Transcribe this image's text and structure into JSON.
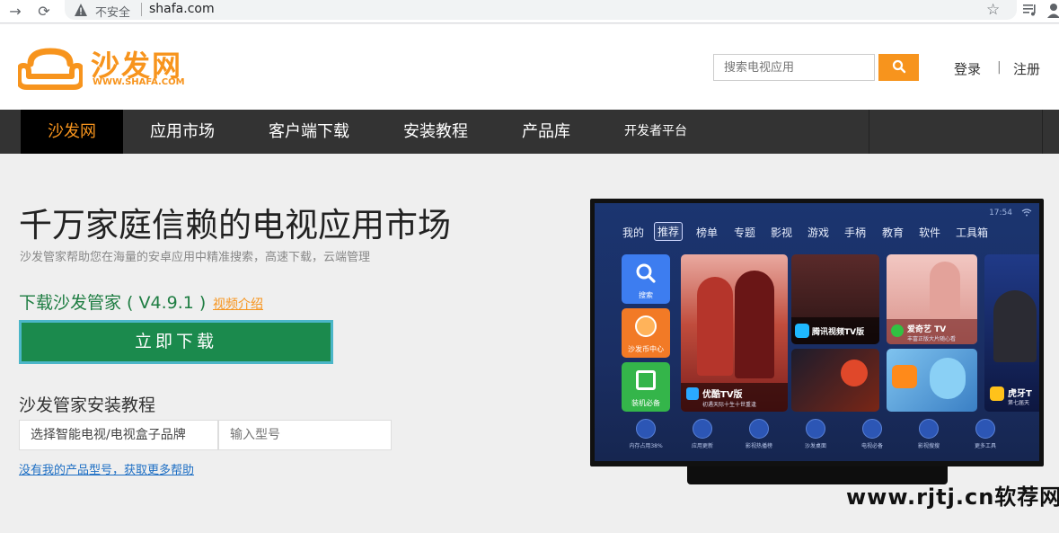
{
  "browser": {
    "security_label": "不安全",
    "url": "shafa.com"
  },
  "header": {
    "logo_cn": "沙发网",
    "logo_en": "WWW.SHAFA.COM",
    "search_placeholder": "搜索电视应用",
    "login": "登录",
    "separator": "|",
    "register": "注册"
  },
  "nav": {
    "items": [
      {
        "label": "沙发网"
      },
      {
        "label": "应用市场"
      },
      {
        "label": "客户端下载"
      },
      {
        "label": "安装教程"
      },
      {
        "label": "产品库"
      },
      {
        "label": "开发者平台"
      }
    ]
  },
  "hero": {
    "title": "千万家庭信赖的电视应用市场",
    "subtitle": "沙发管家帮助您在海量的安卓应用中精准搜索，高速下载，云端管理",
    "download_title": "下载沙发管家 ( V4.9.1 )",
    "video_link": "视频介绍",
    "download_button": "立即下载",
    "tutorial_title": "沙发管家安装教程",
    "brand_select": "选择智能电视/电视盒子品牌",
    "model_placeholder": "输入型号",
    "help_link": "没有我的产品型号，获取更多帮助"
  },
  "tv": {
    "time": "17:54",
    "tabs": [
      "我的",
      "推荐",
      "榜单",
      "专题",
      "影视",
      "游戏",
      "手柄",
      "教育",
      "软件",
      "工具箱"
    ],
    "active_tab": "推荐",
    "left_tiles": [
      "搜索",
      "沙发币中心",
      "装机必备"
    ],
    "featured": {
      "title": "优酷TV版",
      "sub": "初遇天际十生十世重逢"
    },
    "tile_tencent": {
      "title": "腾讯视频TV版"
    },
    "tile_iqiyi": {
      "title": "爱奇艺 TV",
      "sub": "丰富正版大片随心看"
    },
    "tile_huya": {
      "title": "虎牙T",
      "sub": "第七届天"
    },
    "dock": [
      "内存占用38%",
      "应用更新",
      "影视热播榜",
      "沙发桌面",
      "电视必备",
      "影视搜搜",
      "更多工具"
    ]
  },
  "watermark": "www.rjtj.cn软荐网",
  "colors": {
    "brand_orange": "#f7941d",
    "nav_bg": "#333333",
    "download_green": "#1b8a4d",
    "link_blue": "#1e6fc4"
  }
}
